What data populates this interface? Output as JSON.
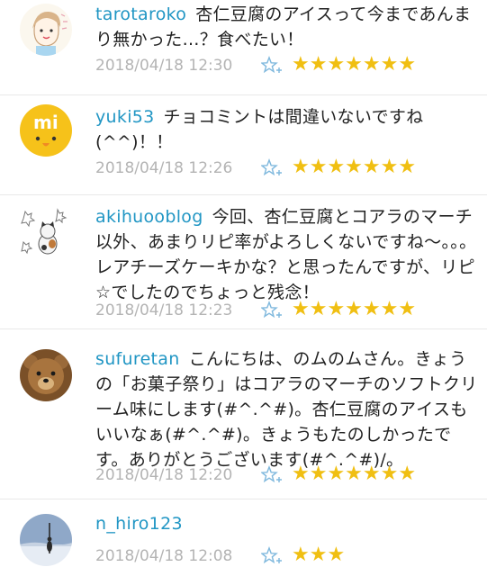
{
  "comments": [
    {
      "username": "tarotaroko",
      "text": "杏仁豆腐のアイスって今まであんまり無かった…？食べたい！",
      "timestamp": "2018/04/18 12:30",
      "stars": "★★★★★★★",
      "star_count": 7,
      "avatar_icon": "child-drawing-avatar-icon"
    },
    {
      "username": "yuki53",
      "text": "チョコミントは間違いないですね(^^)！！",
      "timestamp": "2018/04/18 12:26",
      "stars": "★★★★★★★",
      "star_count": 7,
      "avatar_icon": "yellow-chick-avatar-icon"
    },
    {
      "username": "akihuooblog",
      "text": "今回、杏仁豆腐とコアラのマーチ以外、あまりリピ率がよろしくないですね〜。。。レアチーズケーキかな？と思ったんですが、リピ☆でしたのでちょっと残念！",
      "timestamp": "2018/04/18 12:23",
      "stars": "★★★★★★★",
      "star_count": 7,
      "avatar_icon": "cat-illustration-avatar-icon"
    },
    {
      "username": "sufuretan",
      "text": "こんにちは、のムのムさん。きょうの「お菓子祭り」はコアラのマーチのソフトクリーム味にします(#^.^#)。杏仁豆腐のアイスもいいなぁ(#^.^#)。きょうもたのしかったです。ありがとうございます(#^.^#)/。",
      "timestamp": "2018/04/18 12:20",
      "stars": "★★★★★★★",
      "star_count": 7,
      "avatar_icon": "teddy-bear-avatar-icon"
    },
    {
      "username": "n_hiro123",
      "text": "",
      "timestamp": "2018/04/18 12:08",
      "stars": "★★★",
      "star_count": 3,
      "avatar_icon": "snow-landscape-avatar-icon"
    }
  ],
  "colors": {
    "username": "#2196c4",
    "timestamp": "#b4b4b4",
    "star": "#f0bf12",
    "add_star": "#7fb8dd"
  }
}
